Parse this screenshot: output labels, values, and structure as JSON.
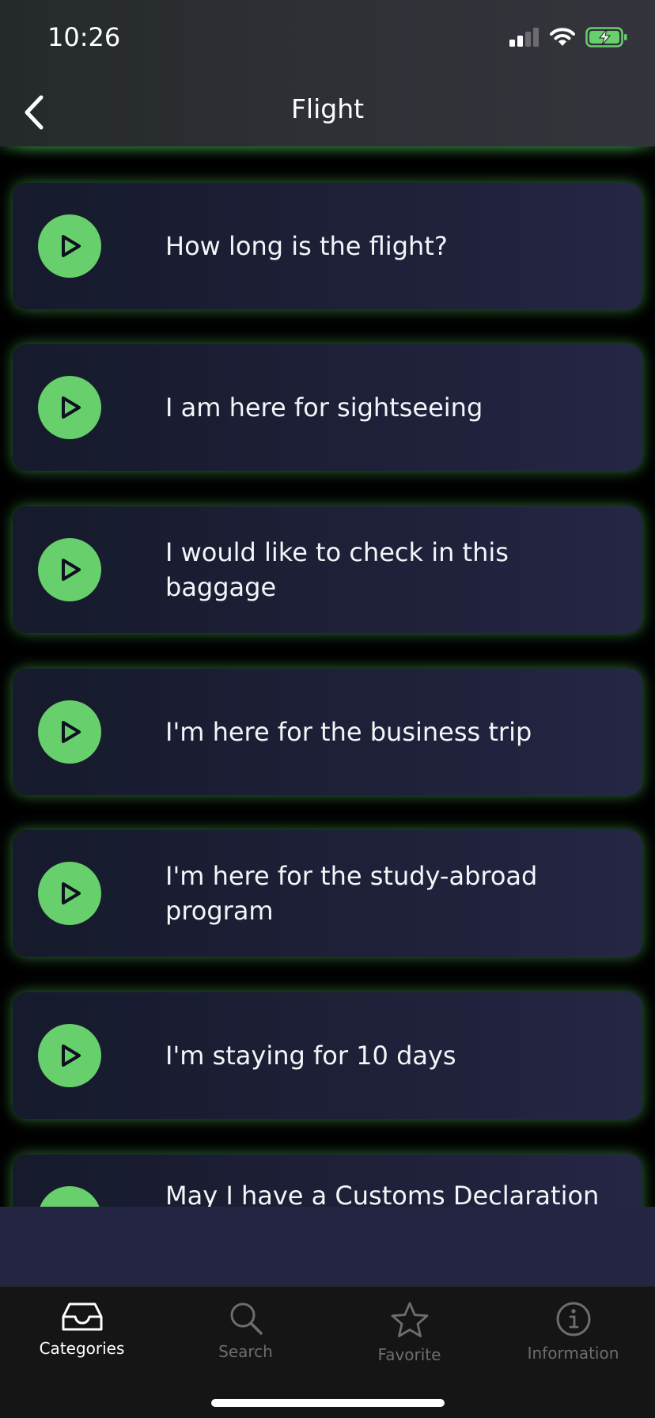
{
  "status_bar": {
    "time": "10:26"
  },
  "header": {
    "title": "Flight"
  },
  "phrases": [
    {
      "text": "How long is the flight?"
    },
    {
      "text": "I am here for sightseeing"
    },
    {
      "text": "I would like to check in this baggage"
    },
    {
      "text": "I'm here for the business trip"
    },
    {
      "text": "I'm here for the study-abroad program"
    },
    {
      "text": "I'm staying for 10 days"
    },
    {
      "text": "May I have a Customs Declaration"
    }
  ],
  "tabs": [
    {
      "label": "Categories",
      "icon": "inbox-icon",
      "active": true
    },
    {
      "label": "Search",
      "icon": "search-icon",
      "active": false
    },
    {
      "label": "Favorite",
      "icon": "star-icon",
      "active": false
    },
    {
      "label": "Information",
      "icon": "info-icon",
      "active": false
    }
  ],
  "colors": {
    "accent_green": "#67cf6b",
    "card_bg": "#1e2038",
    "tab_active": "#ffffff",
    "tab_inactive": "#6d6d72"
  }
}
